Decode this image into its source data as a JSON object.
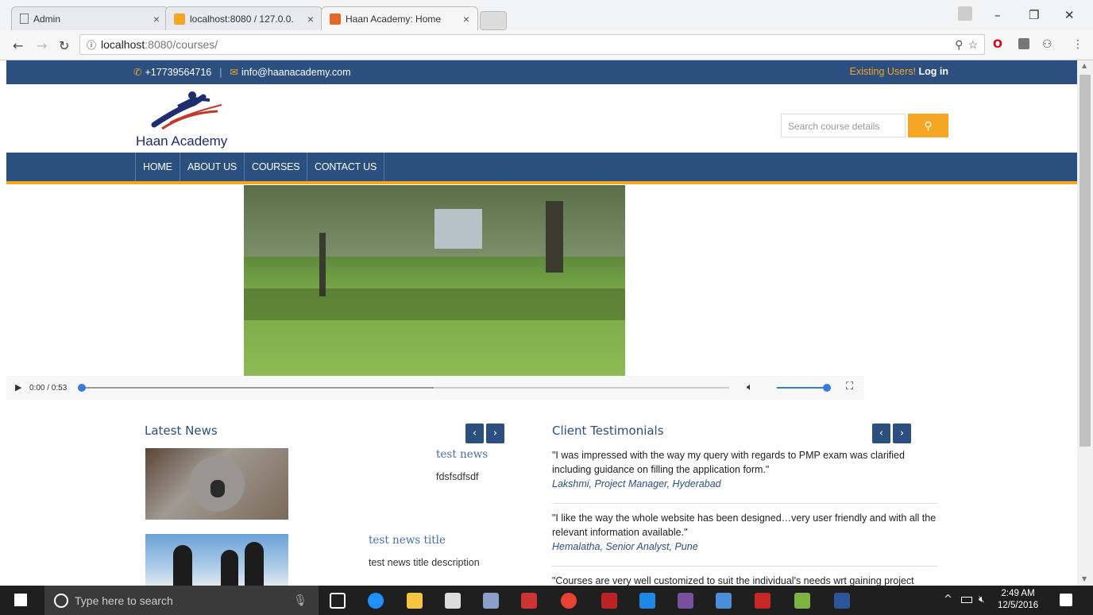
{
  "browser": {
    "tabs": [
      {
        "title": "Admin"
      },
      {
        "title": "localhost:8080 / 127.0.0."
      },
      {
        "title": "Haan Academy: Home"
      }
    ],
    "url_host": "localhost",
    "url_path": ":8080/courses/"
  },
  "topbar": {
    "phone": "+17739564716",
    "email": "info@haanacademy.com",
    "existing_users": "Existing Users!",
    "login": "Log in"
  },
  "header": {
    "logo_text": "Haan Academy",
    "search_placeholder": "Search course details"
  },
  "nav": {
    "items": [
      "HOME",
      "ABOUT US",
      "COURSES",
      "CONTACT US"
    ]
  },
  "video": {
    "time": "0:00 / 0:53"
  },
  "news": {
    "title": "Latest News",
    "items": [
      {
        "title": "test news",
        "desc": "fdsfsdfsdf"
      },
      {
        "title": "test news title",
        "desc": "test news title description"
      }
    ]
  },
  "testimonials": {
    "title": "Client Testimonials",
    "items": [
      {
        "quote": "\"I was impressed with the way my query with regards to PMP exam was clarified including guidance on filling the application form.\"",
        "author": "Lakshmi, Project Manager, Hyderabad"
      },
      {
        "quote": "\"I like the way the whole website has been designed…very user friendly and with all the relevant information available.\"",
        "author": "Hemalatha, Senior Analyst, Pune"
      },
      {
        "quote": "\"Courses are very well customized to suit the individual's needs wrt gaining project",
        "author": ""
      }
    ]
  },
  "taskbar": {
    "search_placeholder": "Type here to search",
    "time": "2:49 AM",
    "date": "12/5/2016"
  },
  "colors": {
    "brand_blue": "#2b4f7e",
    "accent_orange": "#f5a623"
  }
}
